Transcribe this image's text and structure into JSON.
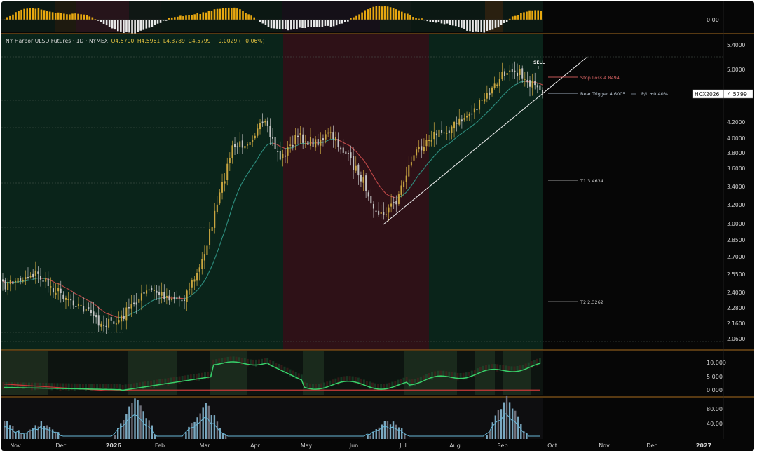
{
  "header": {
    "symbol_title": "NY Harbor ULSD Futures · 1D · NYMEX",
    "open": "O4.5700",
    "high": "H4.5961",
    "low": "L4.3789",
    "close": "C4.5799",
    "change": "−0.0029 (−0.06%)"
  },
  "price_tag": {
    "symbol": "HOX2026",
    "price": "4.5799"
  },
  "annotations": {
    "sell": "SELL",
    "stop_loss": "Stop Loss 4.8494",
    "bear_trigger": "Bear Trigger 4.6005",
    "pl_label": "P/L +0.40%",
    "t1": "T1 3.4634",
    "t2": "T2 2.3262"
  },
  "colors": {
    "background": "#060606",
    "bull_zone": "#0a241a",
    "bear_zone": "#2e1117",
    "candle_up": "#c9a640",
    "candle_down": "#c4c4c4",
    "ema_up": "#2e8f80",
    "ema_down": "#c04848",
    "osc_up": "#e8a810",
    "osc_down": "#e8e8e8",
    "volume": "#5a98b0",
    "panel_border": "#a86c1e",
    "stop_loss": "#c25454",
    "target": "#9a9a9a"
  },
  "chart_data": [
    {
      "type": "candlestick",
      "panel": "price",
      "y_axis_ticks": [
        "5.4000",
        "5.0000",
        "4.2000",
        "4.0000",
        "3.8000",
        "3.6000",
        "3.4000",
        "3.2000",
        "3.0000",
        "2.8500",
        "2.7000",
        "2.5500",
        "2.4000",
        "2.2800",
        "2.1600",
        "2.0600"
      ],
      "x_axis_ticks": [
        "Nov",
        "Dec",
        "2026",
        "Feb",
        "Mar",
        "Apr",
        "May",
        "Jun",
        "Jul",
        "Aug",
        "Sep",
        "Oct",
        "Nov",
        "Dec",
        "2027"
      ],
      "path_points": [
        [
          "Nov",
          2.45
        ],
        [
          "Nov",
          2.51
        ],
        [
          "Nov",
          2.56
        ],
        [
          "Dec",
          2.44
        ],
        [
          "Dec",
          2.36
        ],
        [
          "Dec",
          2.27
        ],
        [
          "2026",
          2.16
        ],
        [
          "2026",
          2.16
        ],
        [
          "2026",
          2.32
        ],
        [
          "Feb",
          2.42
        ],
        [
          "Feb",
          2.37
        ],
        [
          "Feb",
          2.35
        ],
        [
          "Mar",
          2.58
        ],
        [
          "Mar",
          3.12
        ],
        [
          "Mar",
          3.85
        ],
        [
          "Apr",
          3.97
        ],
        [
          "Apr",
          4.18
        ],
        [
          "Apr",
          3.72
        ],
        [
          "May",
          4.02
        ],
        [
          "May",
          3.93
        ],
        [
          "May",
          4.05
        ],
        [
          "Jun",
          3.78
        ],
        [
          "Jun",
          3.47
        ],
        [
          "Jun",
          3.08
        ],
        [
          "Jul",
          3.22
        ],
        [
          "Jul",
          3.72
        ],
        [
          "Jul",
          4.02
        ],
        [
          "Aug",
          4.08
        ],
        [
          "Aug",
          4.22
        ],
        [
          "Aug",
          4.42
        ],
        [
          "Sep",
          4.72
        ],
        [
          "Sep",
          5.05
        ],
        [
          "Sep",
          4.86
        ],
        [
          "Sep",
          4.58
        ]
      ],
      "regimes": [
        {
          "from": "Nov",
          "to": "May",
          "state": "bull"
        },
        {
          "from": "May",
          "to": "Jul",
          "state": "bear"
        },
        {
          "from": "Jul",
          "to": "Sep",
          "state": "bull"
        }
      ],
      "levels": {
        "stop_loss": 4.8494,
        "bear_trigger": 4.6005,
        "t1": 3.4634,
        "t2": 2.3262,
        "last": 4.5799
      }
    },
    {
      "type": "bar",
      "panel": "top-oscillator",
      "y_axis_ticks": [
        "0.00"
      ]
    },
    {
      "type": "line",
      "panel": "middle-oscillator",
      "y_axis_ticks": [
        "10.000",
        "5.000",
        "0.000"
      ]
    },
    {
      "type": "bar",
      "panel": "volume",
      "y_axis_ticks": [
        "80.00",
        "40.00"
      ]
    }
  ]
}
